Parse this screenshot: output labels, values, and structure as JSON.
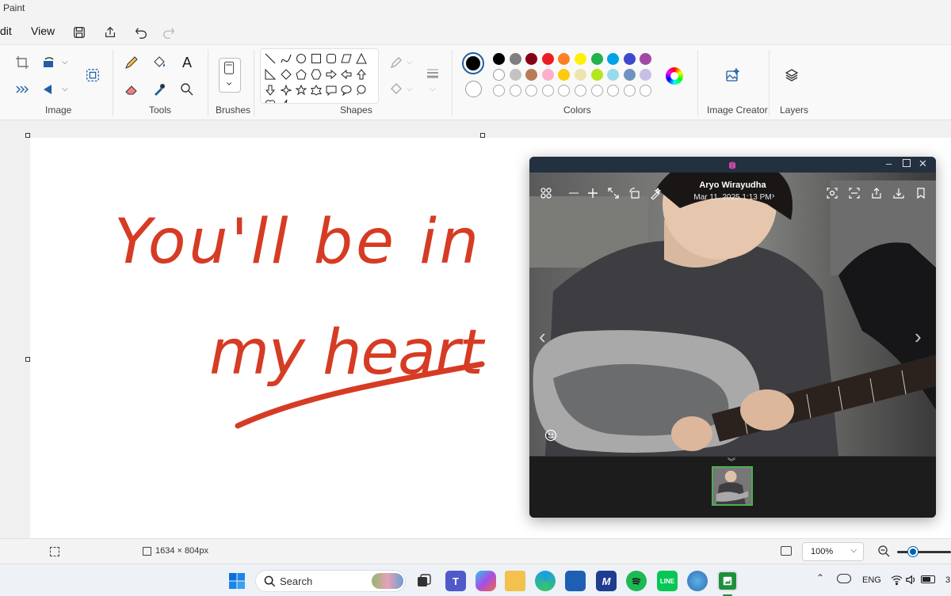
{
  "app": {
    "title": "Paint"
  },
  "menu": {
    "edit": "dit",
    "view": "View"
  },
  "ribbon": {
    "groups": {
      "image": "Image",
      "tools": "Tools",
      "brushes": "Brushes",
      "shapes": "Shapes",
      "colors": "Colors",
      "image_creator": "Image Creator",
      "layers": "Layers"
    },
    "colors": {
      "primary": "#000000",
      "secondary": "#ffffff",
      "row1": [
        "#000000",
        "#7f7f7f",
        "#880015",
        "#ed1c24",
        "#ff7f27",
        "#fff200",
        "#22b14c",
        "#00a2e8",
        "#3f48cc",
        "#a349a4"
      ],
      "row2": [
        "#ffffff",
        "#c3c3c3",
        "#b97a57",
        "#ffaec9",
        "#ffc90e",
        "#efe4b0",
        "#b5e61d",
        "#99d9ea",
        "#7092be",
        "#c8bfe7"
      ]
    }
  },
  "canvas": {
    "ink_color": "#d63b24",
    "text_line1": "You'll be in",
    "text_line2": "my heart"
  },
  "viewer": {
    "author": "Aryo Wirayudha",
    "date": "Mar 11, 2025 1:13 PM"
  },
  "status": {
    "dimensions": "1634 × 804px",
    "zoom": "100%"
  },
  "taskbar": {
    "search_placeholder": "Search",
    "language": "ENG",
    "clock_partial": "3"
  }
}
